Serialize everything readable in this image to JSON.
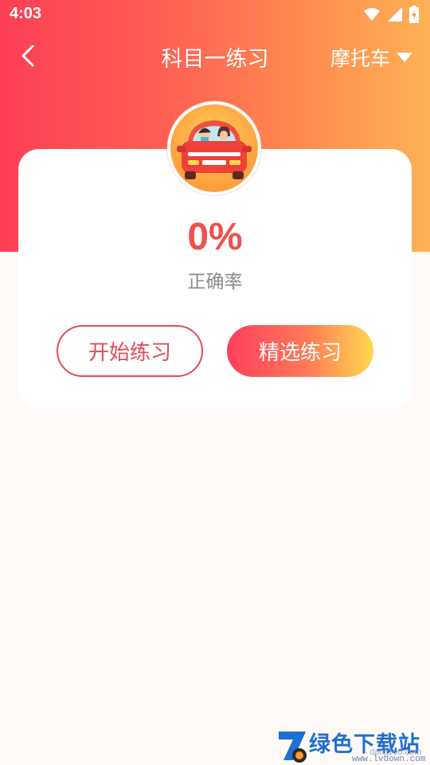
{
  "status_bar": {
    "time": "4:03",
    "icons": [
      "wifi-icon",
      "signal-icon",
      "battery-charging-icon"
    ]
  },
  "header": {
    "back_icon": "chevron-left-icon",
    "title": "科目一练习",
    "vehicle_type": "摩托车",
    "dropdown_icon": "triangle-down-icon"
  },
  "card": {
    "avatar_icon": "car-with-driver-icon",
    "accuracy_value": "0%",
    "accuracy_label": "正确率",
    "start_button": "开始练习",
    "selected_button": "精选练习"
  },
  "watermark": {
    "text": "绿色下载站",
    "url_1": "danji100.com",
    "url_2": "www.lvdown.com"
  },
  "colors": {
    "gradient_start": "#fd3f55",
    "gradient_end": "#ffb255",
    "accent_red": "#f0504f",
    "button_border": "#e84a57",
    "button_gradient_end": "#ffd84f"
  }
}
